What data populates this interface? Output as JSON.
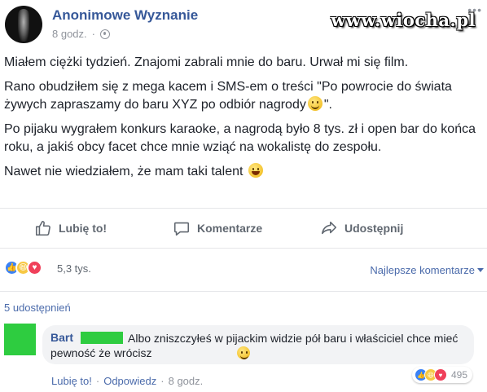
{
  "post": {
    "page_name": "Anonimowe Wyznanie",
    "timestamp": "8 godz.",
    "separator": "·",
    "paragraphs": [
      "Miałem ciężki tydzień. Znajomi zabrali mnie do baru. Urwał mi się film.",
      "Rano obudziłem się z mega kacem i SMS-em o treści \"Po powrocie do świata żywych zapraszamy do baru XYZ po odbiór nagrody",
      "\".",
      "Po pijaku wygrałem konkurs karaoke, a nagrodą było 8 tys. zł i open bar do końca roku, a jakiś obcy facet chce mnie wziąć na wokalistę do zespołu.",
      "Nawet nie wiedziałem, że mam taki talent"
    ]
  },
  "watermark": "www.wiocha.pl",
  "actions": {
    "like": "Lubię to!",
    "comment": "Komentarze",
    "share": "Udostępnij"
  },
  "reactions": {
    "count": "5,3 tys.",
    "sort_label": "Najlepsze komentarze"
  },
  "shares_label": "5 udostępnień",
  "comment": {
    "author": "Bart",
    "text": "Albo zniszczyłeś w pijackim widzie pół baru i właściciel chce mieć pewność że wrócisz",
    "reaction_count": "495",
    "like_label": "Lubię to!",
    "reply_label": "Odpowiedz",
    "separator": "·",
    "timestamp": "8 godz."
  },
  "colors": {
    "link_blue": "#365899",
    "muted": "#90949c",
    "censor_green": "#2ecc40"
  }
}
